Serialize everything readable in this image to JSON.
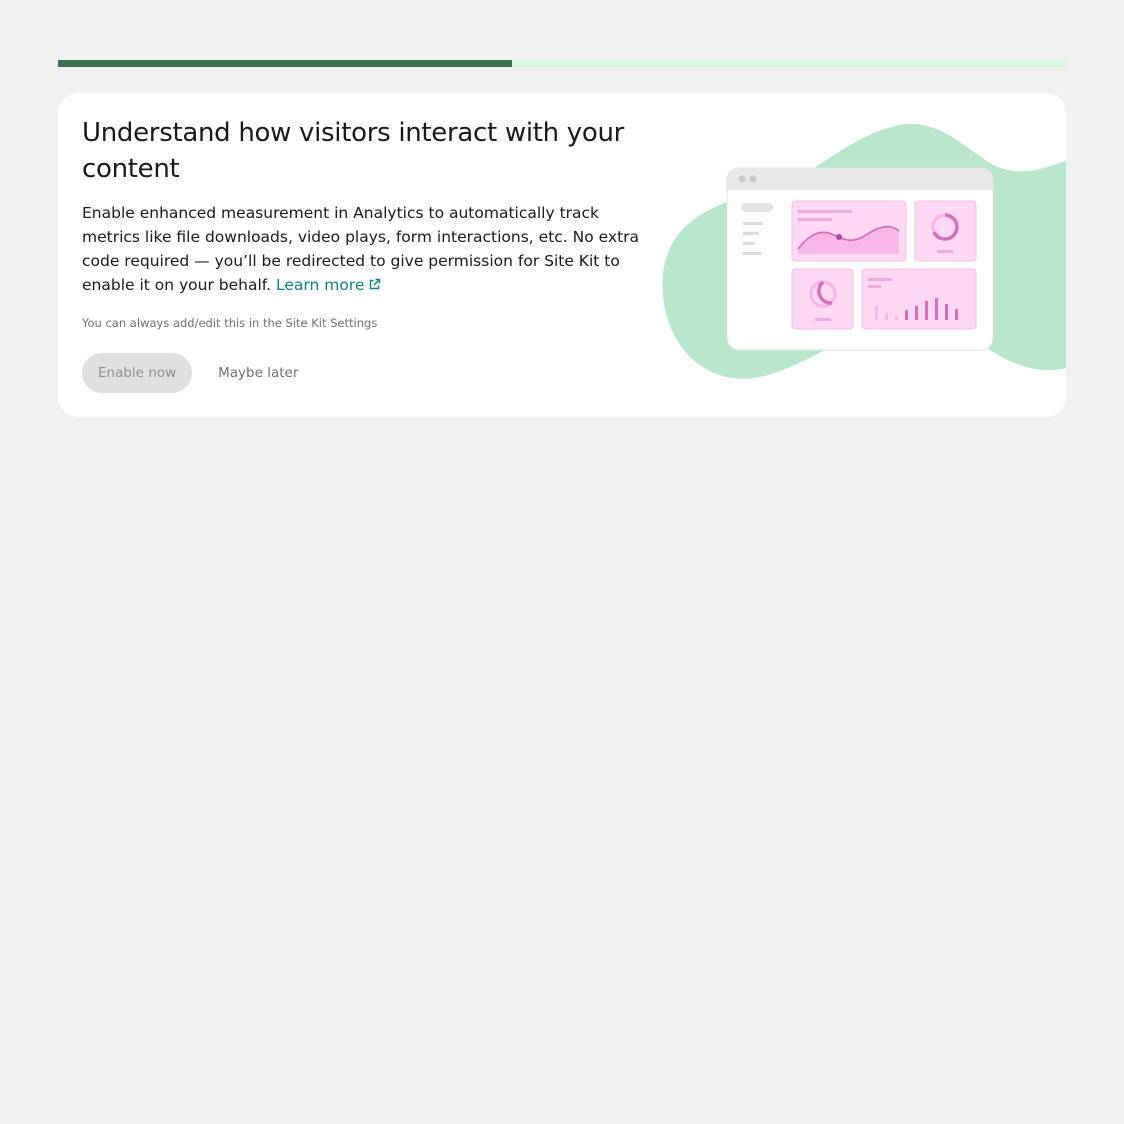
{
  "progress": {
    "value": 0.45,
    "track_color": "#d8f6e0",
    "fill_color": "#3c7251"
  },
  "banner": {
    "title": "Understand how visitors interact with your content",
    "description": "Enable enhanced measurement in Analytics to automatically track metrics like file downloads, video plays, form interactions, etc. No extra code required — you’ll be redirected to give permission for Site Kit to enable it on your behalf.",
    "learn_more": "Learn more",
    "hint": "You can always add/edit this in the Site Kit Settings",
    "enable_button": "Enable now",
    "later_button": "Maybe later"
  },
  "icons": [
    "external-link-icon",
    "dashboard-illustration"
  ],
  "colors": {
    "accent_link": "#108080",
    "illustration_blob": "#b8e6ca",
    "illustration_widget": "#ffd8f4",
    "illustration_mark": "#d66fbe"
  }
}
